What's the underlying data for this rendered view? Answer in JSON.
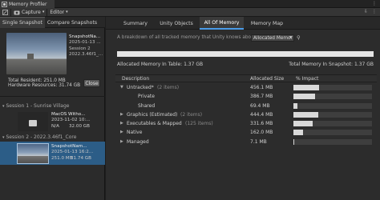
{
  "window": {
    "title": "Memory Profiler"
  },
  "toolbar": {
    "capture_label": "Capture",
    "editor_label": "Editor"
  },
  "left_panel": {
    "tabs": [
      "Single Snapshot",
      "Compare Snapshots"
    ],
    "current_snapshot": {
      "name": "SnapshotNa...",
      "date": "2025-01-13 ...",
      "session": "Session 2",
      "version": "2022.3.46f1_..."
    },
    "total_resident": "Total Resident: 251.0 MB",
    "hardware_resources": "Hardware Resources: 31.74 GB",
    "close_label": "Close",
    "sessions": [
      {
        "title": "Session 1 - Sunrise Village",
        "snapshots": [
          {
            "name": "MacOS Witho...",
            "date": "2023-11-02 10:...",
            "left": "N/A",
            "right": "32.00 GB",
            "selected": false
          }
        ]
      },
      {
        "title": "Session 2 - 2022.3.46f1_Core",
        "snapshots": [
          {
            "name": "SnapshotNam...",
            "date": "2025-01-13 16:2...",
            "left": "251.0 MB",
            "right": "31.74 GB",
            "selected": true
          }
        ]
      }
    ]
  },
  "right_panel": {
    "tabs": [
      "Summary",
      "Unity Objects",
      "All Of Memory",
      "Memory Map"
    ],
    "active_tab": "All Of Memory",
    "description": "A breakdown of all tracked memory that Unity knows about.",
    "dropdown_value": "Allocated Memor",
    "allocated_in_table": "Allocated Memory In Table: 1.37 GB",
    "total_in_snapshot": "Total Memory In Snapshot: 1.37 GB",
    "columns": {
      "description": "Description",
      "size": "Allocated Size",
      "impact": "% Impact"
    },
    "rows": [
      {
        "label": "Untracked*",
        "count": "(2 items)",
        "size": "456.1 MB",
        "impact": 0.33,
        "expanded": true,
        "indent": 0
      },
      {
        "label": "Private",
        "count": "",
        "size": "386.7 MB",
        "impact": 0.28,
        "expanded": null,
        "indent": 1
      },
      {
        "label": "Shared",
        "count": "",
        "size": "69.4 MB",
        "impact": 0.05,
        "expanded": null,
        "indent": 1
      },
      {
        "label": "Graphics (Estimated)",
        "count": "(2 items)",
        "size": "444.4 MB",
        "impact": 0.32,
        "expanded": false,
        "indent": 0
      },
      {
        "label": "Executables & Mapped",
        "count": "(125 items)",
        "size": "331.6 MB",
        "impact": 0.24,
        "expanded": false,
        "indent": 0
      },
      {
        "label": "Native",
        "count": "",
        "size": "162.0 MB",
        "impact": 0.12,
        "expanded": false,
        "indent": 0
      },
      {
        "label": "Managed",
        "count": "",
        "size": "7.1 MB",
        "impact": 0.01,
        "expanded": false,
        "indent": 0
      }
    ]
  }
}
